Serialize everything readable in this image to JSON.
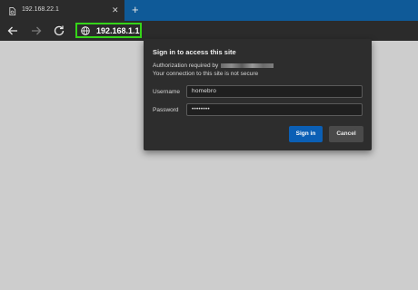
{
  "tab": {
    "title": "192.168.22.1",
    "close": "✕",
    "new_tab": "+"
  },
  "toolbar": {
    "url": "192.168.1.1"
  },
  "dialog": {
    "title": "Sign in to access this site",
    "auth_prefix": "Authorization required by",
    "warning": "Your connection to this site is not secure",
    "username_label": "Username",
    "username_value": "homebro",
    "password_label": "Password",
    "password_value": "••••••••",
    "sign_in": "Sign in",
    "cancel": "Cancel"
  },
  "colors": {
    "tabstrip": "#0f5a98",
    "address_highlight": "#35d419",
    "primary_button": "#0b5fb5"
  },
  "icons": [
    "page-icon",
    "close-icon",
    "plus-icon",
    "back-arrow-icon",
    "forward-arrow-icon",
    "refresh-icon",
    "globe-icon"
  ]
}
